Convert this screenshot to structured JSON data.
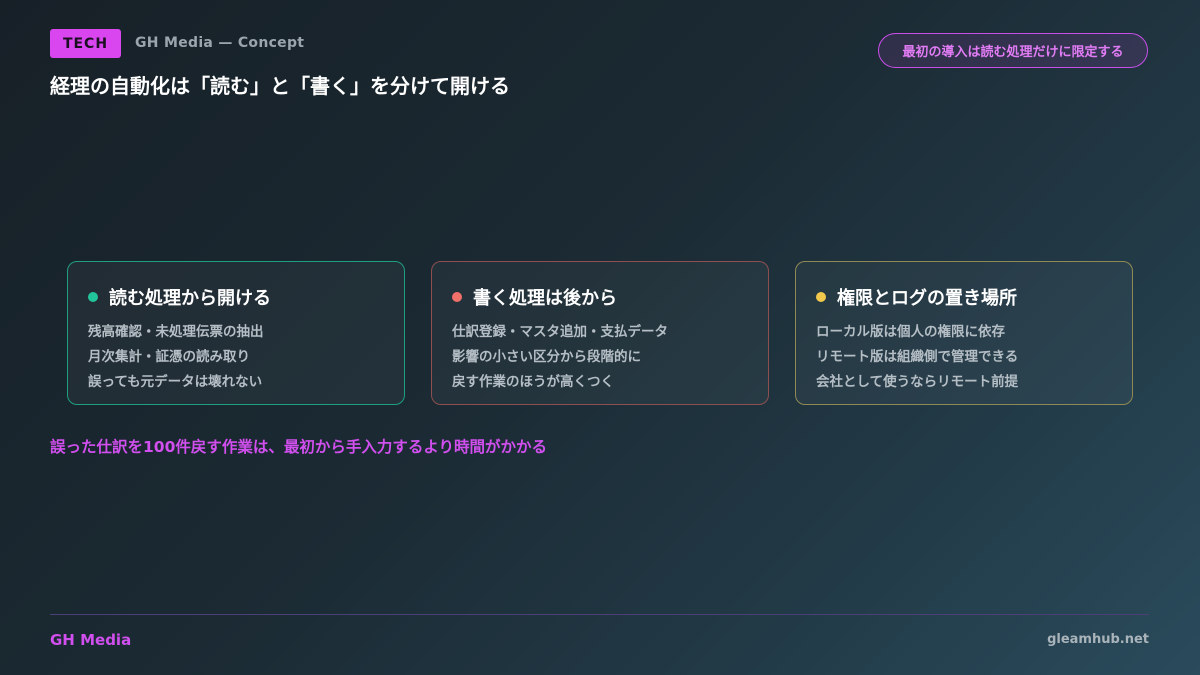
{
  "header": {
    "tag": "TECH",
    "brandline": "GH Media — Concept",
    "title": "経理の自動化は「読む」と「書く」を分けて開ける",
    "pill": "最初の導入は読む処理だけに限定する"
  },
  "cards": [
    {
      "title": "読む処理から開ける",
      "accent": "#22c59a",
      "lines": [
        "残高確認・未処理伝票の抽出",
        "月次集計・証憑の読み取り",
        "誤っても元データは壊れない"
      ]
    },
    {
      "title": "書く処理は後から",
      "accent": "#f0706a",
      "lines": [
        "仕訳登録・マスタ追加・支払データ",
        "影響の小さい区分から段階的に",
        "戻す作業のほうが高くつく"
      ]
    },
    {
      "title": "権限とログの置き場所",
      "accent": "#f2c94c",
      "lines": [
        "ローカル版は個人の権限に依存",
        "リモート版は組織側で管理できる",
        "会社として使うならリモート前提"
      ]
    }
  ],
  "note": "誤った仕訳を100件戻す作業は、最初から手入力するより時間がかかる",
  "footer": {
    "brand": "GH Media",
    "url": "gleamhub.net"
  },
  "colors": {
    "accent": "#d946ef"
  }
}
